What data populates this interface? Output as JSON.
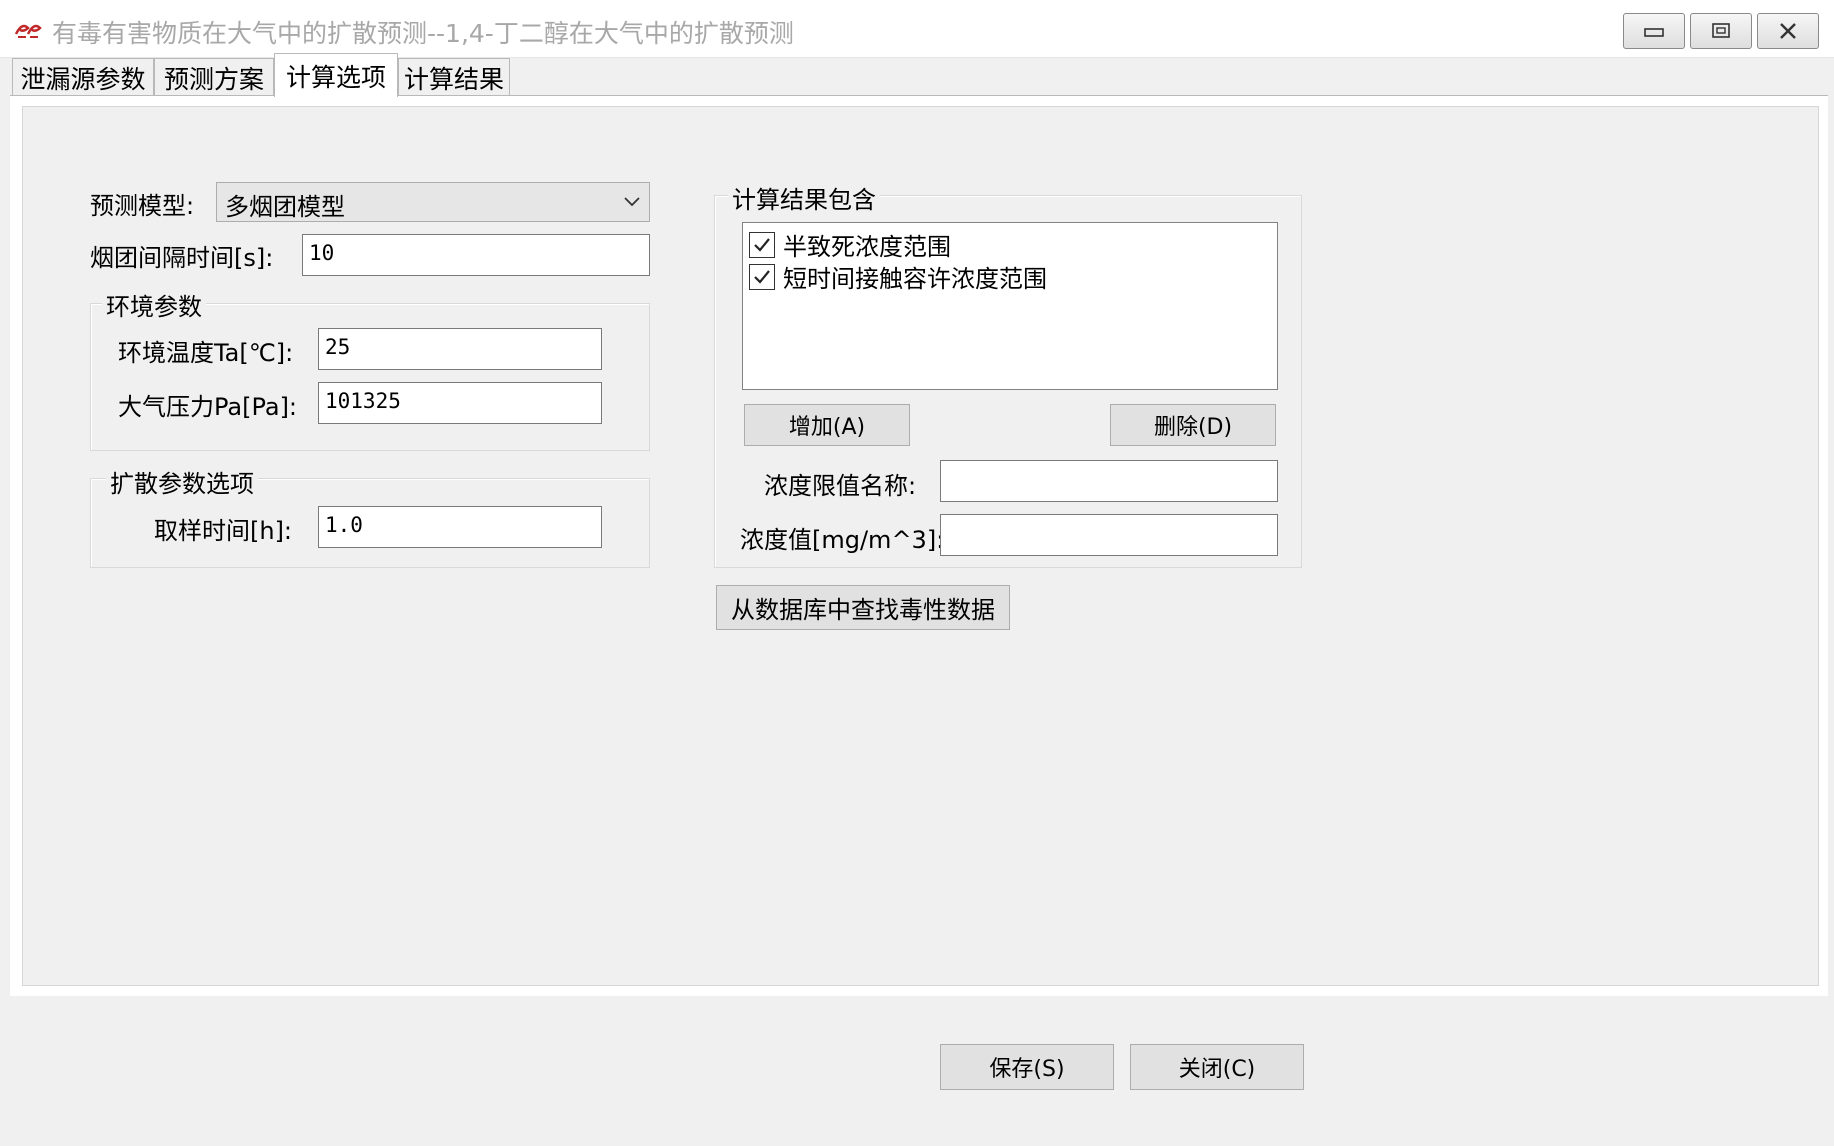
{
  "window": {
    "title": "有毒有害物质在大气中的扩散预测--1,4-丁二醇在大气中的扩散预测",
    "controls": [
      "minimize",
      "maximize",
      "close"
    ]
  },
  "tabs": [
    {
      "label": "泄漏源参数",
      "active": false
    },
    {
      "label": "预测方案",
      "active": false
    },
    {
      "label": "计算选项",
      "active": true
    },
    {
      "label": "计算结果",
      "active": false
    }
  ],
  "options": {
    "model_label": "预测模型:",
    "model_value": "多烟团模型",
    "puff_interval_label": "烟团间隔时间[s]:",
    "puff_interval_value": "10"
  },
  "environment": {
    "legend": "环境参数",
    "temp_label": "环境温度Ta[℃]:",
    "temp_value": "25",
    "pressure_label": "大气压力Pa[Pa]:",
    "pressure_value": "101325"
  },
  "dispersion": {
    "legend": "扩散参数选项",
    "sampling_label": "取样时间[h]:",
    "sampling_value": "1.0"
  },
  "results_include": {
    "legend": "计算结果包含",
    "items": [
      {
        "label": "半致死浓度范围",
        "checked": true
      },
      {
        "label": "短时间接触容许浓度范围",
        "checked": true
      }
    ],
    "add_button": "增加(A)",
    "delete_button": "删除(D)",
    "limit_name_label": "浓度限值名称:",
    "limit_name_value": "",
    "conc_label": "浓度值[mg/m^3]:",
    "conc_value": ""
  },
  "db_button": "从数据库中查找毒性数据",
  "footer": {
    "save_button": "保存(S)",
    "close_button": "关闭(C)"
  },
  "colors": {
    "window_bg": "#f0f0f0",
    "title_text": "#a8a8a8",
    "app_icon": "#c0282a"
  }
}
